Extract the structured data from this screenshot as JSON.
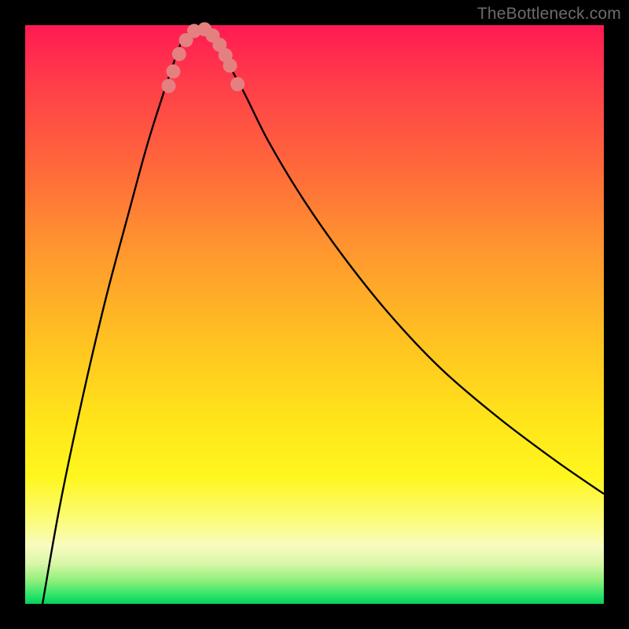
{
  "watermark": "TheBottleneck.com",
  "colors": {
    "frame": "#000000",
    "curve": "#000000",
    "marker": "#e58080",
    "gradient_top": "#ff1a52",
    "gradient_bottom": "#07cf5a"
  },
  "chart_data": {
    "type": "line",
    "title": "",
    "xlabel": "",
    "ylabel": "",
    "xlim": [
      0,
      100
    ],
    "ylim": [
      0,
      100
    ],
    "note": "No axis ticks or numeric labels are rendered in the source image; x/y values below are estimated as percentages of plot width/height with y=0 at top (highest bottleneck) and y=100 at bottom (optimal).",
    "series": [
      {
        "name": "bottleneck-curve",
        "x": [
          3,
          6,
          10,
          14,
          18,
          21,
          23.5,
          25.5,
          27,
          28.5,
          30,
          31.5,
          33,
          35,
          38,
          42,
          48,
          55,
          63,
          72,
          82,
          92,
          100
        ],
        "y": [
          0,
          17,
          36,
          53,
          68,
          79,
          87,
          93,
          97,
          99,
          100,
          99,
          97,
          93.5,
          88,
          80,
          70,
          60,
          50,
          40.5,
          32,
          24.5,
          19
        ]
      }
    ],
    "markers": {
      "name": "highlighted-points",
      "x": [
        24.8,
        25.6,
        26.6,
        27.8,
        29.2,
        31.0,
        32.4,
        33.6,
        34.6,
        35.4,
        36.7
      ],
      "y": [
        89.5,
        92.0,
        95.0,
        97.4,
        99.0,
        99.3,
        98.2,
        96.6,
        94.8,
        93.0,
        89.8
      ]
    }
  }
}
